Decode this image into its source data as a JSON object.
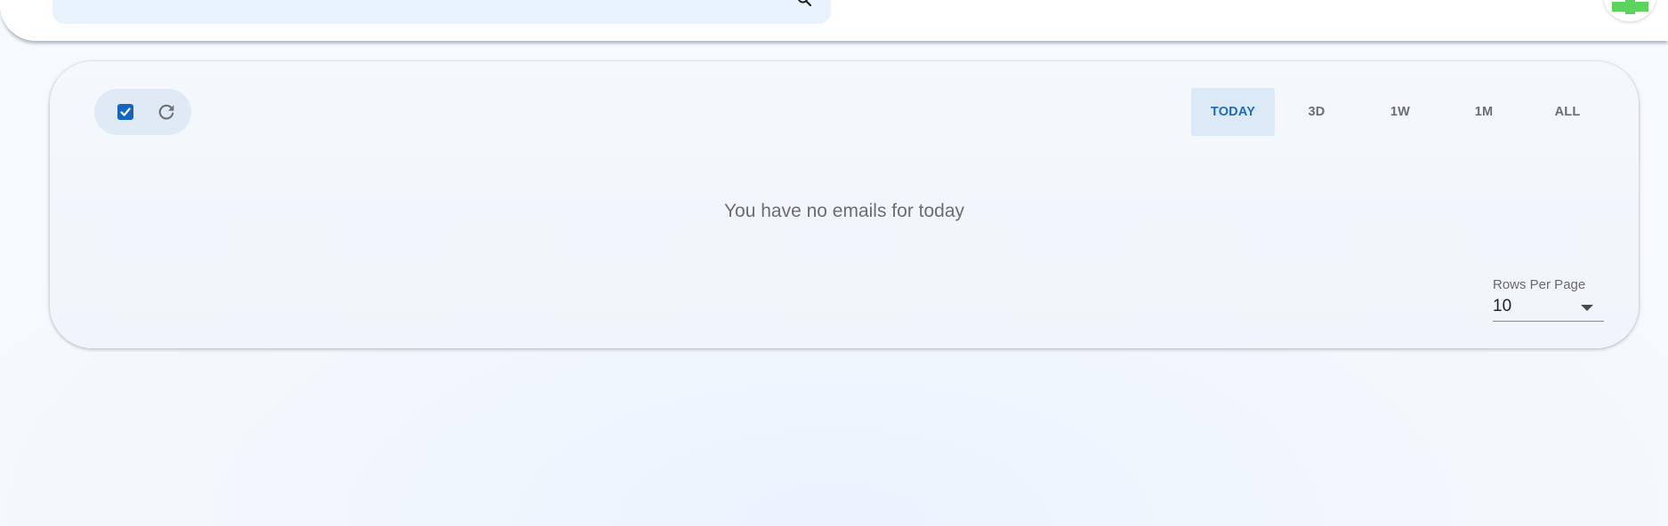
{
  "header": {
    "search_icon": "search-icon",
    "compose_icon": "plus-icon",
    "compose_color": "#5cd35c"
  },
  "toolbar": {
    "select_all_checked": true,
    "select_all_icon": "checkbox-checked-icon",
    "refresh_icon": "refresh-icon",
    "accent": "#1565c0"
  },
  "filters": {
    "active": "TODAY",
    "tabs": [
      "TODAY",
      "3D",
      "1W",
      "1M",
      "ALL"
    ]
  },
  "main": {
    "empty_message": "You have no emails for today"
  },
  "pagination": {
    "rows_label": "Rows Per Page",
    "rows_value": "10"
  }
}
